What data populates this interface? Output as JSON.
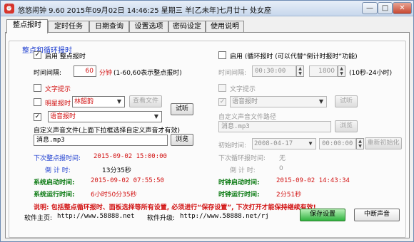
{
  "window": {
    "title": "悠悠闹钟 9.60 2015年09月02日 14:46:25 星期三 羊[乙未年]七月廿十 处女座",
    "min_glyph": "—",
    "max_glyph": "□",
    "close_glyph": "✕"
  },
  "tabs": [
    "整点报时",
    "定时任务",
    "日期查询",
    "设置选项",
    "密码设定",
    "使用说明"
  ],
  "group_title": "整点和循环报时",
  "left": {
    "enable_label": "启用 整点报时",
    "interval_label": "时间间隔:",
    "interval_value": "60",
    "interval_unit": "分钟",
    "interval_hint": "(1-60,60表示整点报时)",
    "text_tip_label": "文字提示",
    "star_label": "明星报时",
    "star_value": "林韶韵",
    "view_file": "查看文件",
    "voice_label": "语音报时",
    "listen": "试听",
    "custom_file_label": "自定义声音文件(上面下拉框选择自定义声音才有效)",
    "custom_file_value": "消息.mp3",
    "browse": "浏览",
    "next_label": "下次整点报时间:",
    "next_value": "2015-09-02 15:00:00",
    "countdown_label": "倒 计 时:",
    "countdown_value": "13分35秒",
    "sys_start_label": "系统启动时间:",
    "sys_start_value": "2015-09-02 07:55:50",
    "sys_run_label": "系统运行时间:",
    "sys_run_value": "6小时50分35秒"
  },
  "right": {
    "enable_label": "启用 (循环报时 (可以代替“倒计时报时”功能)",
    "interval_label": "时间间隔:",
    "interval_value": "00:30:00",
    "seconds_value": "1800",
    "seconds_hint": "(10秒-24小时)",
    "text_tip_label": "文字提示",
    "voice_label": "语音报时",
    "listen": "试听",
    "custom_path_label": "自定义声音文件路径",
    "custom_file_value": "消息.mp3",
    "browse": "浏览",
    "init_label": "初始时间:",
    "init_date": "2008-04-17",
    "init_time": "00:00:00",
    "reinit": "重新初始化",
    "next_label": "下次循环报时间:",
    "next_value": "无",
    "countdown_label": "倒 计 时:",
    "countdown_value": "0",
    "clock_start_label": "时钟启动时间:",
    "clock_start_value": "2015-09-02 14:43:34",
    "clock_run_label": "时钟运行时间:",
    "clock_run_value": "2分51秒"
  },
  "note": "说明: 包括整点循环报时、面板选择等所有设置, 必须进行“保存设置”, 下次打开才能保持继续有效!",
  "footer": {
    "home_label": "软件主页:",
    "home_url": "http://www.58888.net",
    "upgrade_label": "软件升级:",
    "upgrade_url": "http://www.58888.net/rj",
    "save": "保存设置",
    "stop": "中断声音"
  },
  "glyphs": {
    "check": "✓",
    "arrow_down": "▼",
    "spin_up": "▲",
    "spin_down": "▼"
  }
}
